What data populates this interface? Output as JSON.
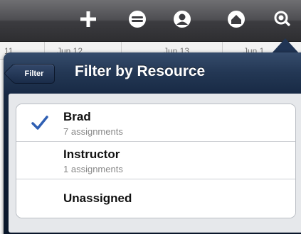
{
  "toolbar": {
    "icons": [
      "add-icon",
      "link-icon",
      "person-icon",
      "home-icon",
      "search-icon"
    ]
  },
  "dates": [
    "11",
    "Jun 12",
    "Jun 13",
    "Jun 1"
  ],
  "popover": {
    "back_label": "Filter",
    "title": "Filter by Resource"
  },
  "resources": [
    {
      "name": "Brad",
      "subtitle": "7 assignments",
      "selected": true
    },
    {
      "name": "Instructor",
      "subtitle": "1 assignments",
      "selected": false
    },
    {
      "name": "Unassigned",
      "subtitle": "",
      "selected": false
    }
  ],
  "colors": {
    "accent_check": "#2f5fb3",
    "header": "#233754",
    "toolbar": "#4e4e52"
  }
}
